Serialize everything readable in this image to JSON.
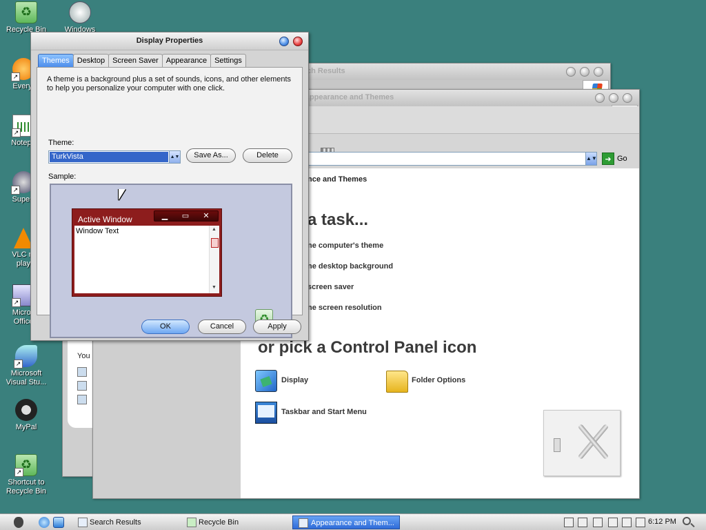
{
  "desktop": {
    "icons": [
      {
        "label": "Recycle Bin"
      },
      {
        "label": "Windows"
      },
      {
        "label": "Everyt"
      },
      {
        "label": "Notepa"
      },
      {
        "label": "Superr"
      },
      {
        "label": "VLC m\nplay"
      },
      {
        "label": "Micros\nOffice"
      },
      {
        "label": "Microsoft\nVisual Stu..."
      },
      {
        "label": "MyPal"
      },
      {
        "label": "Shortcut to\nRecycle Bin"
      }
    ]
  },
  "search_window": {
    "title": "ch Results",
    "balloon_text": "You r"
  },
  "control_panel": {
    "title": "Appearance and Themes",
    "go_label": "Go",
    "category_title": "nce and Themes",
    "pick_task": "a task...",
    "tasks": [
      "ne computer's theme",
      "ne desktop background",
      "screen saver",
      "ne screen resolution"
    ],
    "pick_icon": "or pick a Control Panel icon",
    "icons": [
      {
        "label": "Display",
        "icon": "display-icon"
      },
      {
        "label": "Folder Options",
        "icon": "folder-options-icon"
      },
      {
        "label": "Taskbar and Start Menu",
        "icon": "taskbar-start-menu-icon"
      }
    ]
  },
  "display_properties": {
    "title": "Display Properties",
    "tabs": [
      {
        "label": "Themes",
        "active": true
      },
      {
        "label": "Desktop"
      },
      {
        "label": "Screen Saver"
      },
      {
        "label": "Appearance"
      },
      {
        "label": "Settings"
      }
    ],
    "description": "A theme is a background plus a set of sounds, icons, and other elements to help you personalize your computer with one click.",
    "theme_label": "Theme:",
    "theme_value": "TurkVista",
    "save_as": "Save As...",
    "delete": "Delete",
    "sample_label": "Sample:",
    "sample_window_title": "Active Window",
    "sample_window_text": "Window Text",
    "ok": "OK",
    "cancel": "Cancel",
    "apply": "Apply"
  },
  "taskbar": {
    "items": [
      {
        "label": "Search Results"
      },
      {
        "label": "Recycle Bin"
      },
      {
        "label": "Appearance and Them...",
        "active": true
      }
    ],
    "clock": "6:12 PM"
  },
  "colors": {
    "desktop": "#3a807d",
    "sample_window": "#8d1d1d",
    "selection": "#3466c9"
  }
}
